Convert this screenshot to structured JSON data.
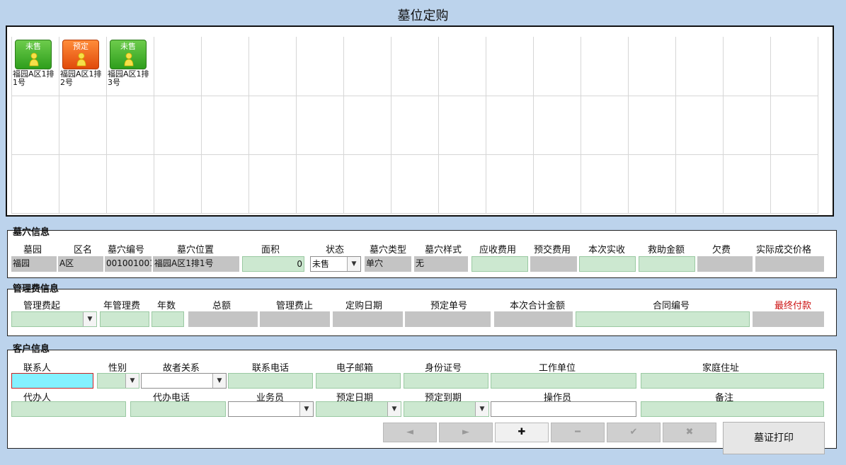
{
  "window": {
    "title": "墓位定购"
  },
  "grid": {
    "tiles": [
      {
        "status": "未售",
        "caption_line1": "福园A区1排",
        "caption_line2": "1号",
        "color": "#3aa82a"
      },
      {
        "status": "预定",
        "caption_line1": "福园A区1排",
        "caption_line2": "2号",
        "color": "#e8541a"
      },
      {
        "status": "未售",
        "caption_line1": "福园A区1排",
        "caption_line2": "3号",
        "color": "#3aa82a"
      }
    ]
  },
  "tomb_info": {
    "title": "墓穴信息",
    "labels": {
      "cemetery": "墓园",
      "zone": "区名",
      "tomb_no": "墓穴编号",
      "location": "墓穴位置",
      "area": "面积",
      "status": "状态",
      "tomb_type": "墓穴类型",
      "tomb_style": "墓穴样式",
      "receivable": "应收费用",
      "prepaid": "预交费用",
      "received_now": "本次实收",
      "aid": "救助金额",
      "owed": "欠费",
      "actual_price": "实际成交价格"
    },
    "values": {
      "cemetery": "福园",
      "zone": "A区",
      "tomb_no": "001001001",
      "location": "福园A区1排1号",
      "area": "0",
      "status": "未售",
      "tomb_type": "单穴",
      "tomb_style": "无",
      "receivable": "",
      "prepaid": "",
      "received_now": "",
      "aid": "",
      "owed": "",
      "actual_price": ""
    }
  },
  "mgmt_info": {
    "title": "管理费信息",
    "labels": {
      "fee_start": "管理费起",
      "annual_fee": "年管理费",
      "years": "年数",
      "total": "总额",
      "fee_end": "管理费止",
      "purchase_date": "定购日期",
      "reservation_no": "预定单号",
      "total_now": "本次合计金额",
      "contract_no": "合同编号",
      "final_payment": "最终付款"
    },
    "values": {
      "fee_start": "",
      "annual_fee": "",
      "years": "",
      "total": "",
      "fee_end": "",
      "purchase_date": "",
      "reservation_no": "",
      "total_now": "",
      "contract_no": "",
      "final_payment": ""
    },
    "final_payment_color": "#cc1111"
  },
  "customer_info": {
    "title": "客户信息",
    "labels": {
      "contact": "联系人",
      "gender": "性别",
      "relation": "故者关系",
      "phone": "联系电话",
      "email": "电子邮箱",
      "id_no": "身份证号",
      "employer": "工作单位",
      "address": "家庭住址",
      "agent": "代办人",
      "agent_phone": "代办电话",
      "salesperson": "业务员",
      "reserve_date": "预定日期",
      "reserve_expiry": "预定到期",
      "operator": "操作员",
      "remarks": "备注"
    },
    "values": {
      "contact": "",
      "gender": "",
      "relation": "",
      "phone": "",
      "email": "",
      "id_no": "",
      "employer": "",
      "address": "",
      "agent": "",
      "agent_phone": "",
      "salesperson": "",
      "reserve_date": "",
      "reserve_expiry": "",
      "operator": "",
      "remarks": ""
    }
  },
  "toolbar": {
    "first_icon": "◄",
    "next_icon": "►",
    "add_icon": "✚",
    "delete_icon": "━",
    "confirm_icon": "✔",
    "cancel_icon": "✖",
    "print_label": "墓证打印"
  }
}
